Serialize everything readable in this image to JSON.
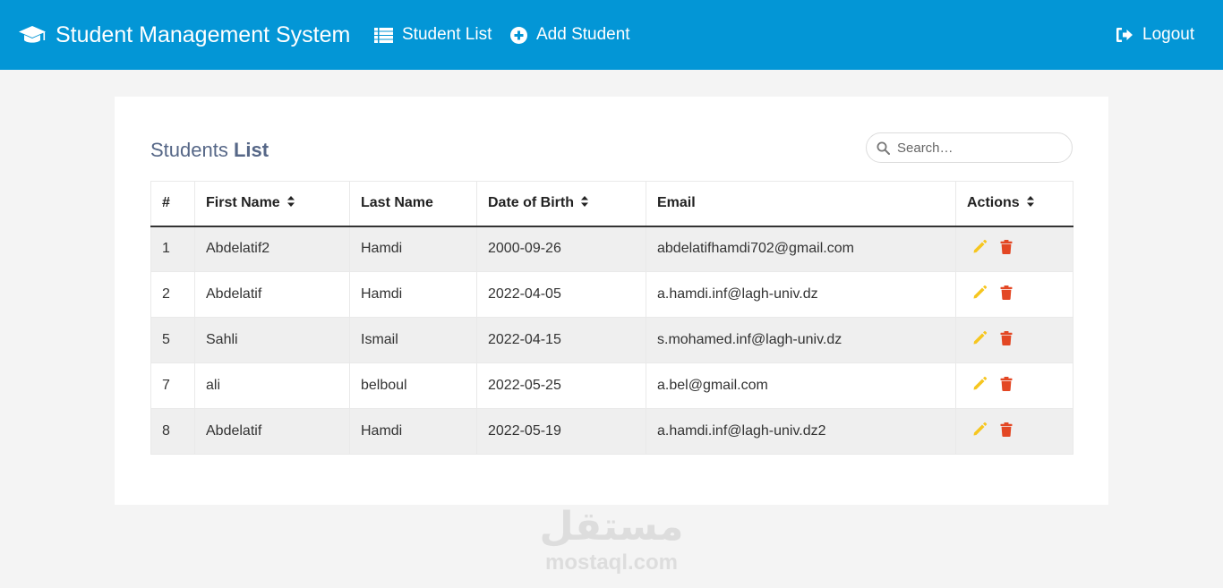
{
  "navbar": {
    "brand_title": "Student Management System",
    "brand_icon": "graduation-cap-icon",
    "links": [
      {
        "label": "Student List",
        "icon": "list-icon"
      },
      {
        "label": "Add Student",
        "icon": "plus-circle-icon"
      }
    ],
    "logout_label": "Logout",
    "logout_icon": "sign-out-icon",
    "background_color": "#0396d6"
  },
  "main": {
    "title_prefix": "Students",
    "title_bold": "List",
    "search": {
      "placeholder": "Search…",
      "value": ""
    },
    "table": {
      "columns": [
        {
          "label": "#",
          "sortable": false
        },
        {
          "label": "First Name",
          "sortable": true
        },
        {
          "label": "Last Name",
          "sortable": false
        },
        {
          "label": "Date of Birth",
          "sortable": true
        },
        {
          "label": "Email",
          "sortable": false
        },
        {
          "label": "Actions",
          "sortable": true
        }
      ],
      "rows": [
        {
          "id": "1",
          "first_name": "Abdelatif2",
          "last_name": "Hamdi",
          "dob": "2000-09-26",
          "email": "abdelatifhamdi702@gmail.com"
        },
        {
          "id": "2",
          "first_name": "Abdelatif",
          "last_name": "Hamdi",
          "dob": "2022-04-05",
          "email": "a.hamdi.inf@lagh-univ.dz"
        },
        {
          "id": "5",
          "first_name": "Sahli",
          "last_name": "Ismail",
          "dob": "2022-04-15",
          "email": "s.mohamed.inf@lagh-univ.dz"
        },
        {
          "id": "7",
          "first_name": "ali",
          "last_name": "belboul",
          "dob": "2022-05-25",
          "email": "a.bel@gmail.com"
        },
        {
          "id": "8",
          "first_name": "Abdelatif",
          "last_name": "Hamdi",
          "dob": "2022-05-19",
          "email": "a.hamdi.inf@lagh-univ.dz2"
        }
      ],
      "action_icons": {
        "edit": "pencil-icon",
        "delete": "trash-icon"
      },
      "colors": {
        "edit": "#f6c61f",
        "delete": "#e34724",
        "stripe": "#efefef"
      }
    }
  },
  "watermark": {
    "logo_text": "مستقل",
    "text": "mostaql.com"
  }
}
